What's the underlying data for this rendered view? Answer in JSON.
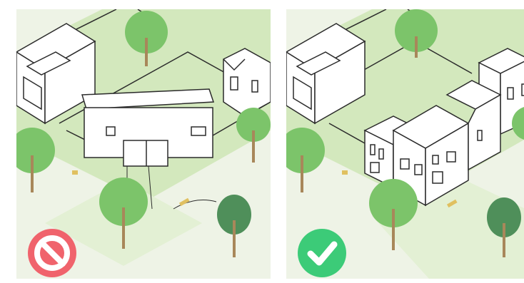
{
  "figure": {
    "panels": [
      {
        "id": "bad",
        "verdict_icon": "prohibited-icon",
        "icon_color": "#f0636c",
        "building": "single-large-house"
      },
      {
        "id": "good",
        "verdict_icon": "checkmark-icon",
        "icon_color": "#3ccb78",
        "building": "multiple-smaller-houses"
      }
    ],
    "colors": {
      "lawn": "#d3e8bd",
      "lawn_light": "#e3f0d4",
      "street": "#eef3e6",
      "tree_canopy": "#7cc46a",
      "tree_canopy_dark": "#4f8f5a",
      "trunk": "#a8875a",
      "outline": "#2b2b2b"
    }
  }
}
